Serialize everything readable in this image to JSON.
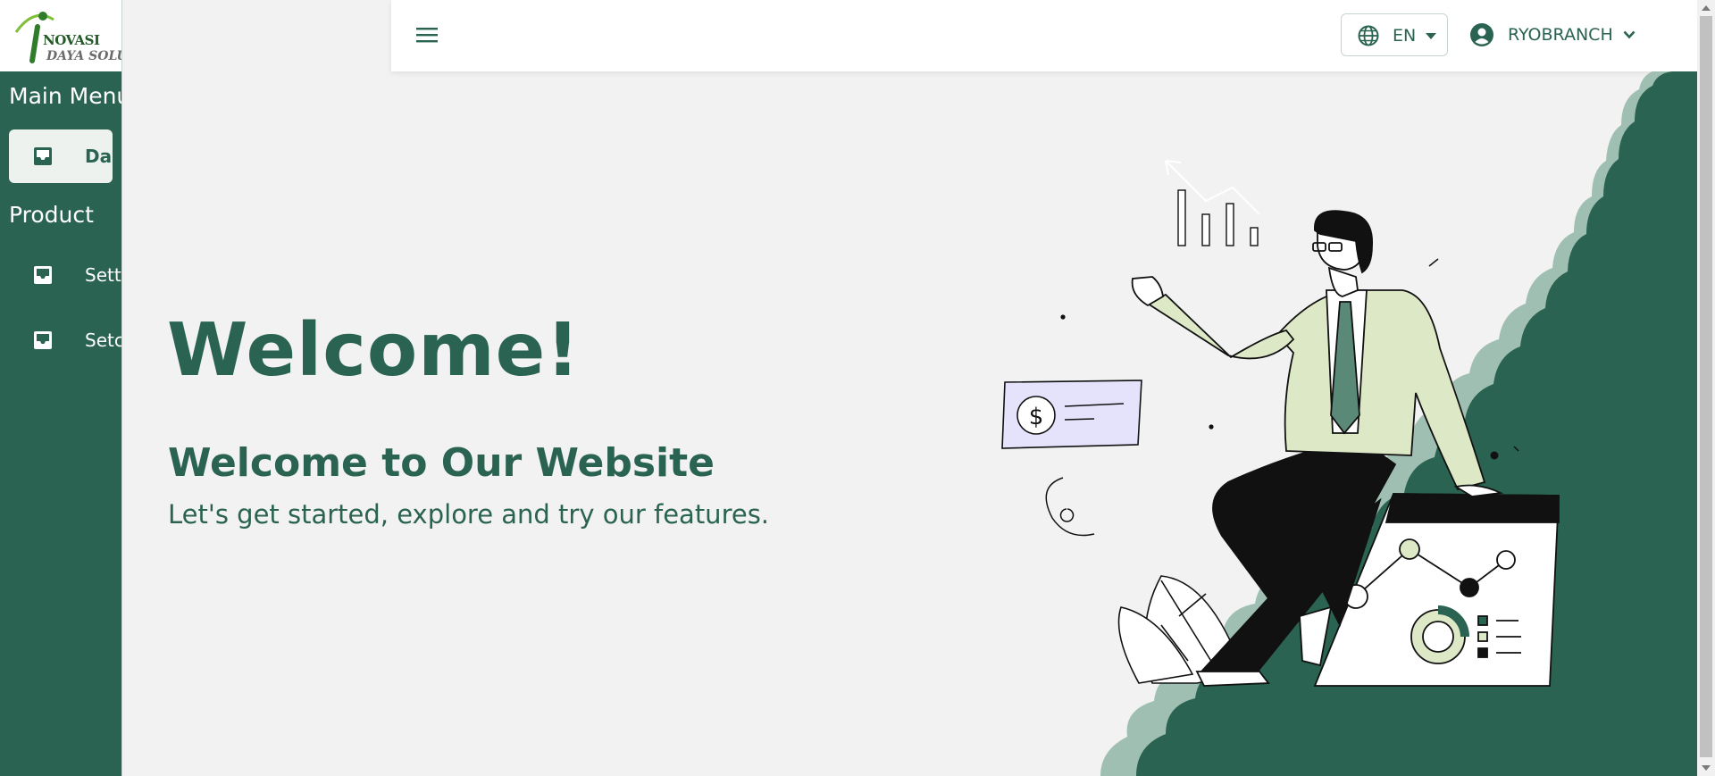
{
  "logo": {
    "word": "NOVASI",
    "sub": "DAYA SOLUSI"
  },
  "sidebar": {
    "sections": [
      "Main Menu",
      "Product"
    ],
    "items": [
      {
        "label": "Dashboard",
        "icon": "inbox-icon",
        "active": true
      },
      {
        "label": "Settings",
        "icon": "inbox-icon",
        "active": false
      },
      {
        "label": "Setcode",
        "icon": "inbox-icon",
        "active": false
      }
    ]
  },
  "header": {
    "language": "EN",
    "user": "RYOBRANCH"
  },
  "hero": {
    "title": "Welcome!",
    "subtitle": "Welcome to Our Website",
    "description": "Let's get started, explore and try our features."
  },
  "colors": {
    "primary": "#2a6351",
    "light_green": "#dce8c6",
    "sage": "#9fbfb2",
    "lavender": "#e4e3fb",
    "background": "#f1f2f1"
  },
  "icons": [
    "hamburger-icon",
    "globe-icon",
    "caret-down-icon",
    "user-circle-icon",
    "chevron-down-icon",
    "inbox-icon",
    "dollar-icon"
  ]
}
